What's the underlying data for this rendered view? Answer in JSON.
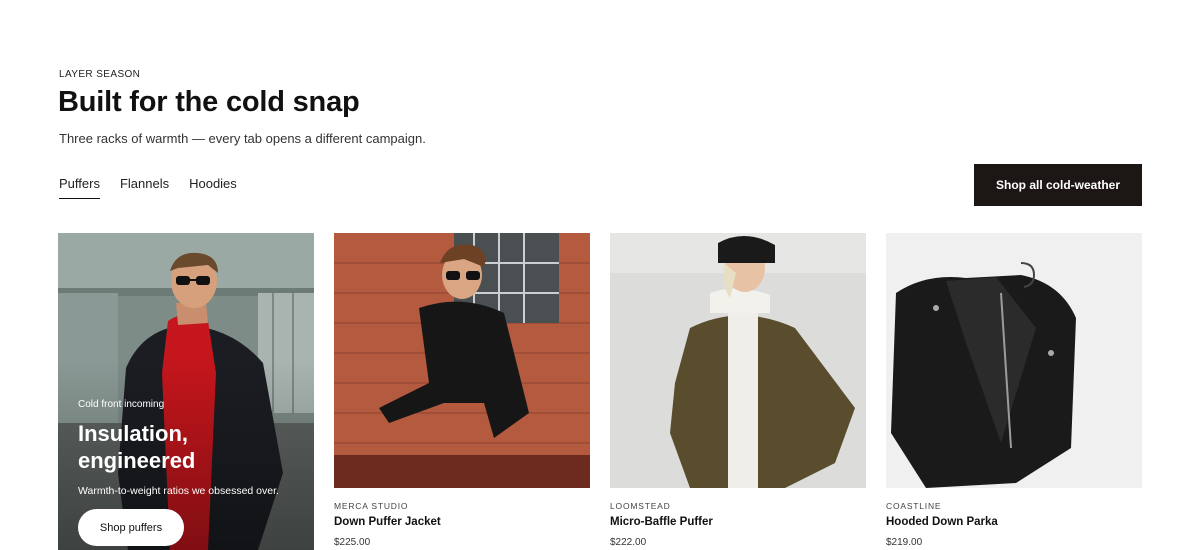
{
  "header": {
    "eyebrow": "LAYER SEASON",
    "title": "Built for the cold snap",
    "subtitle": "Three racks of warmth — every tab opens a different campaign."
  },
  "tabs": [
    {
      "label": "Puffers",
      "active": true
    },
    {
      "label": "Flannels",
      "active": false
    },
    {
      "label": "Hoodies",
      "active": false
    }
  ],
  "cta": {
    "label": "Shop all cold-weather"
  },
  "promo": {
    "kicker": "Cold front incoming",
    "headline": "Insulation, engineered",
    "text": "Warmth-to-weight ratios we obsessed over.",
    "button": "Shop puffers"
  },
  "products": [
    {
      "brand": "MERCA STUDIO",
      "name": "Down Puffer Jacket",
      "price": "$225.00"
    },
    {
      "brand": "LOOMSTEAD",
      "name": "Micro-Baffle Puffer",
      "price": "$222.00"
    },
    {
      "brand": "COASTLINE",
      "name": "Hooded Down Parka",
      "price": "$219.00"
    }
  ],
  "colors": {
    "accent": "#1c1715",
    "background": "#ffffff"
  }
}
